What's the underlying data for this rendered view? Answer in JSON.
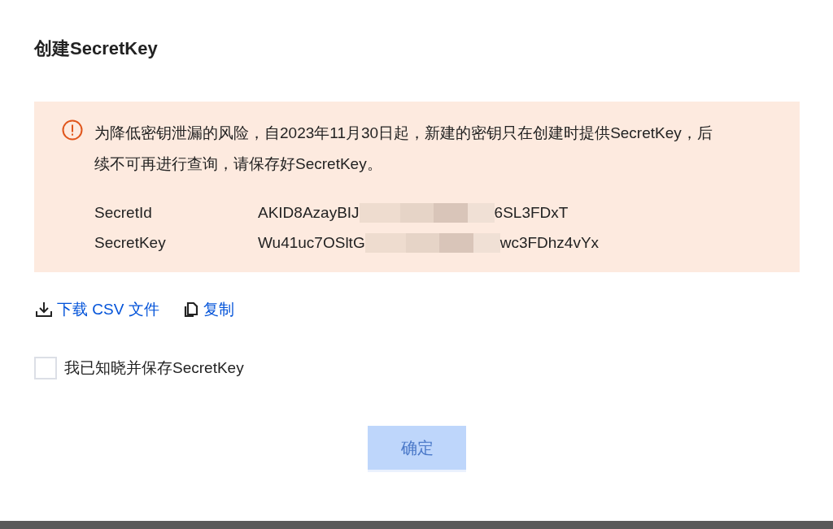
{
  "dialog": {
    "title": "创建SecretKey"
  },
  "notice": {
    "message": "为降低密钥泄漏的风险，自2023年11月30日起，新建的密钥只在创建时提供SecretKey，后续不可再进行查询，请保存好SecretKey。",
    "keys": [
      {
        "label": "SecretId",
        "value_start": "AKID8AzayBIJ",
        "value_end": "6SL3FDxT"
      },
      {
        "label": "SecretKey",
        "value_start": "Wu41uc7OSltG",
        "value_end": "wc3FDhz4vYx"
      }
    ]
  },
  "actions": [
    {
      "kind": "download",
      "label": "下载 CSV 文件"
    },
    {
      "kind": "copy",
      "label": "复制"
    }
  ],
  "acknowledge": {
    "label": "我已知晓并保存SecretKey",
    "checked": false
  },
  "confirm_button": {
    "label": "确定",
    "disabled": true
  }
}
